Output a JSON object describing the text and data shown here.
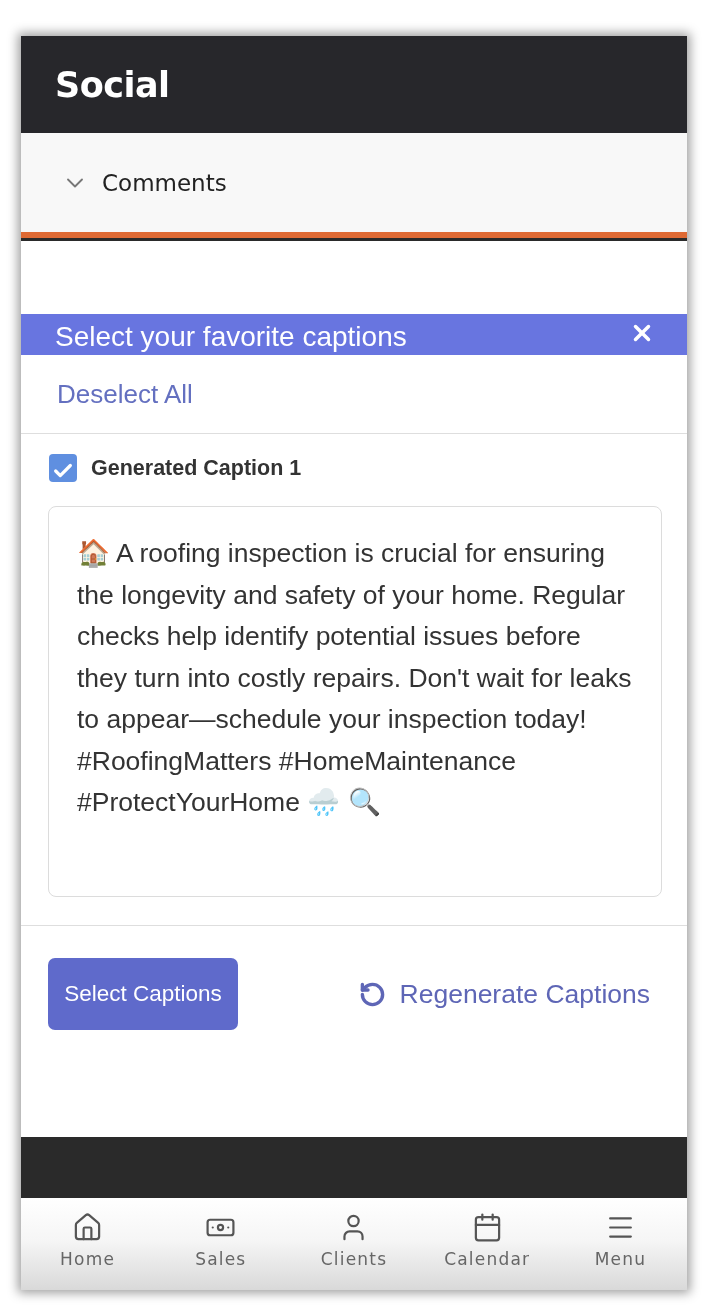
{
  "header": {
    "title": "Social"
  },
  "accordion": {
    "label": "Comments",
    "expanded": false
  },
  "modal": {
    "title": "Select your favorite captions",
    "deselect_all": "Deselect All",
    "captions": [
      {
        "label": "Generated Caption 1",
        "checked": true,
        "text": "🏠 A roofing inspection is crucial for ensuring the longevity and safety of your home. Regular checks help identify potential issues before they turn into costly repairs. Don't wait for leaks to appear—schedule your inspection today! #RoofingMatters #HomeMaintenance #ProtectYourHome 🌧️ 🔍"
      }
    ],
    "primary_button": "Select Captions",
    "secondary_button": "Regenerate Captions"
  },
  "nav": [
    {
      "kind": "home",
      "label": "Home",
      "selected": false
    },
    {
      "kind": "sales",
      "label": "Sales",
      "selected": false
    },
    {
      "kind": "clients",
      "label": "Clients",
      "selected": false
    },
    {
      "kind": "calendar",
      "label": "Calendar",
      "selected": false
    },
    {
      "kind": "menu",
      "label": "Menu",
      "selected": false
    }
  ]
}
